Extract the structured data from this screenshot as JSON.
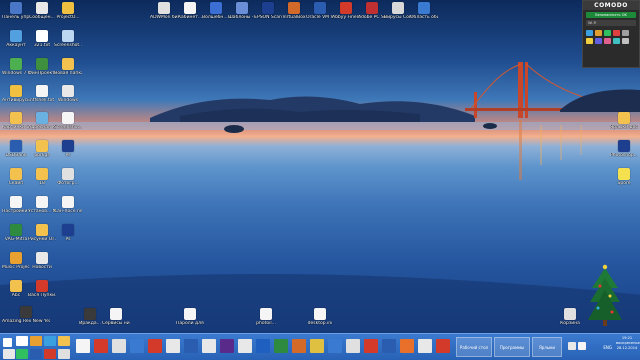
{
  "desktop_icons": [
    {
      "label": "Панель управл...",
      "color": "#4a76c8"
    },
    {
      "label": "Сообщен...",
      "color": "#e8e8e8"
    },
    {
      "label": "ProjectO...",
      "color": "#f0c040"
    },
    {
      "label": "ADWMon бизнест...",
      "color": "#e0e0e0"
    },
    {
      "label": "Кабинет...",
      "color": "#f5f5f5"
    },
    {
      "label": "Волшебн... открыт...",
      "color": "#3b6fd4"
    },
    {
      "label": "Шаблоны - ярлык",
      "color": "#6a8fd8"
    },
    {
      "label": "EPSON Scan",
      "color": "#1c3f8f"
    },
    {
      "label": "VirtualBox",
      "color": "#d46a2a"
    },
    {
      "label": "Oracle VM VirtualBox",
      "color": "#2a5db0"
    },
    {
      "label": "Abbyy Finereader",
      "color": "#d43a2a"
    },
    {
      "label": "Adobe PC Suite",
      "color": "#c03030"
    },
    {
      "label": "Вирусы Comodo",
      "color": "#d8d8d8"
    },
    {
      "label": "Область общего...",
      "color": "#3a7ad0"
    },
    {
      "label": "Аккаунт",
      "color": "#52a0e0"
    },
    {
      "label": "321.txt",
      "color": "#ffffff"
    },
    {
      "label": "Screenshot...",
      "color": "#bcd6f2"
    },
    {
      "label": "Windows 7 Проекты",
      "color": "#4caf50"
    },
    {
      "label": "ФинПроекты",
      "color": "#3e8f3e"
    },
    {
      "label": "Новая папка",
      "color": "#f2c14e"
    },
    {
      "label": "Антивирусы",
      "color": "#f0c040"
    },
    {
      "label": "ntfshell.txt",
      "color": "#f5f5f5"
    },
    {
      "label": "Windows",
      "color": "#e8e8e8"
    },
    {
      "label": "Картинки и открыт...",
      "color": "#f2c14e"
    },
    {
      "label": "Адресная книга",
      "color": "#6ab0e0"
    },
    {
      "label": "Screenshot...",
      "color": "#f5f5f5"
    },
    {
      "label": "DSDBank",
      "color": "#2a5db0"
    },
    {
      "label": "pbrkgs",
      "color": "#f2c14e"
    },
    {
      "label": "Ps",
      "color": "#1e3f8f"
    },
    {
      "label": "Скайп",
      "color": "#f2c14e"
    },
    {
      "label": "18",
      "color": "#f2c14e"
    },
    {
      "label": "Фотогр...",
      "color": "#e0e0e0"
    },
    {
      "label": "Настройки Satellite",
      "color": "#f5f5f5"
    },
    {
      "label": "Установ... Модули",
      "color": "#f5f5f5"
    },
    {
      "label": "Сан-Хосе network...",
      "color": "#f5f5f5"
    },
    {
      "label": "VAG-Mitra",
      "color": "#2e8a3e"
    },
    {
      "label": "Рисунки ОГЭ",
      "color": "#f2c14e"
    },
    {
      "label": "Ps",
      "color": "#1e3f8f"
    },
    {
      "label": "Music Project",
      "color": "#e8a030"
    },
    {
      "label": "Новости",
      "color": "#e8e8e8"
    },
    {
      "label": "Abc",
      "color": "#f2c14e"
    },
    {
      "label": "Вася Пупки...",
      "color": "#d43a2a"
    },
    {
      "label": "Amazing Rex New Year Wallpap...",
      "color": "#3a3a3a"
    },
    {
      "label": "Иракда...",
      "color": "#3a3a3a"
    },
    {
      "label": "Сервисы ниябиц...",
      "color": "#f5f5f5"
    },
    {
      "label": "Пароли для cmd...",
      "color": "#f5f5f5"
    },
    {
      "label": "photoil...",
      "color": "#f5f5f5"
    },
    {
      "label": "desktop.ini",
      "color": "#f5f5f5"
    },
    {
      "label": "Корзина",
      "color": "#e0e0e0"
    },
    {
      "label": "Ярлыки доступа",
      "color": "#f2c14e"
    },
    {
      "label": "Photoshop...",
      "color": "#1e3f8f"
    },
    {
      "label": "Spore",
      "color": "#f5e050"
    }
  ],
  "comodo": {
    "brand": "COMODO",
    "status": "Безопасность OK",
    "row_label": "Wi-Fi"
  },
  "taskbar": {
    "buttons": [
      "Рабочий стол",
      "Программы",
      "Ярлыки"
    ],
    "lang": "ENG",
    "clock_time": "19:21",
    "clock_day": "воскресенье",
    "clock_date": "28.12.2014"
  },
  "colors": {
    "taskbar": "#2862b6",
    "comodo_green": "#1d8a3a"
  }
}
